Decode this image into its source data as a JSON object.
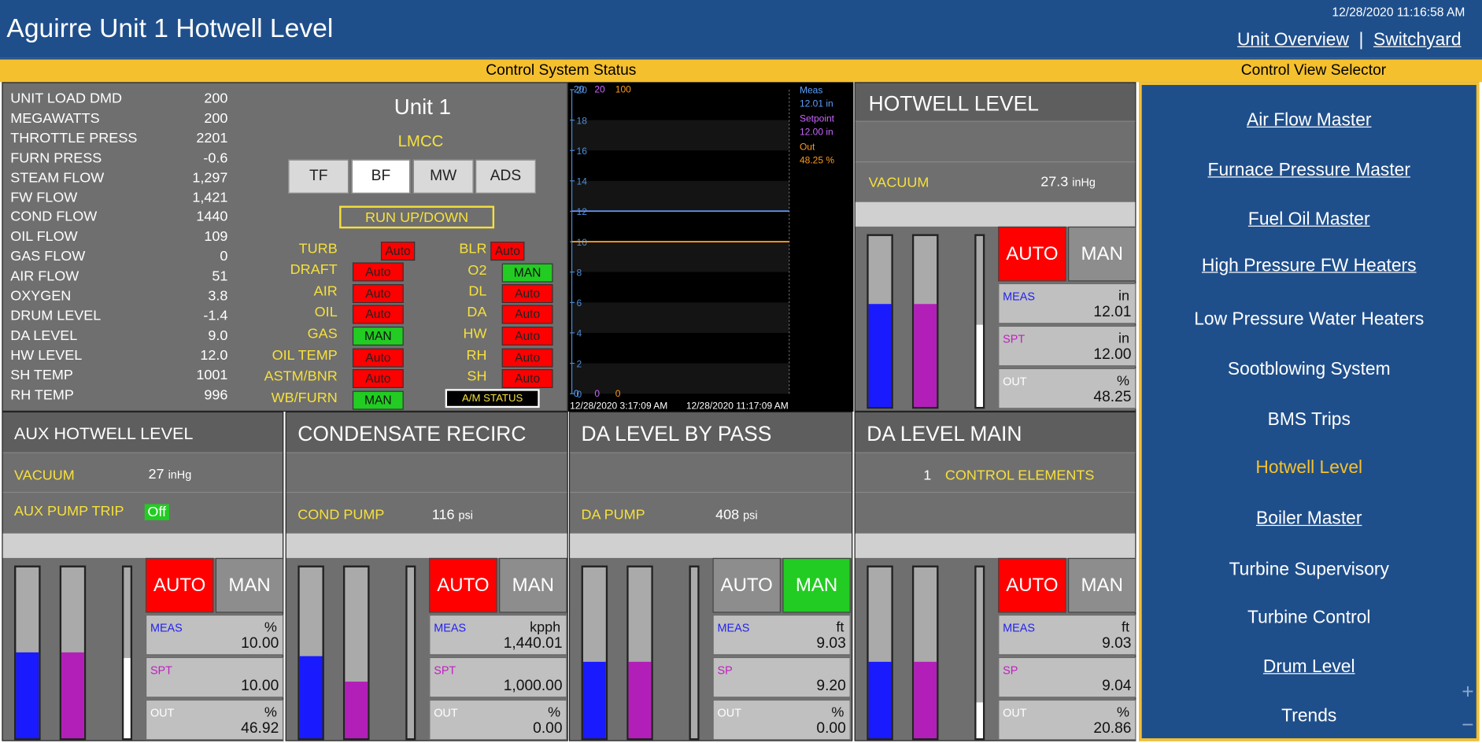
{
  "header": {
    "title": "Aguirre Unit 1 Hotwell Level",
    "timestamp": "12/28/2020 11:16:58 AM",
    "links": [
      "Unit Overview",
      "Switchyard"
    ],
    "separator": "|"
  },
  "bar": {
    "left": "Control System Status",
    "right": "Control View Selector"
  },
  "status_list": [
    {
      "label": "UNIT LOAD DMD",
      "value": "200"
    },
    {
      "label": "MEGAWATTS",
      "value": "200"
    },
    {
      "label": "THROTTLE PRESS",
      "value": "2201"
    },
    {
      "label": "FURN PRESS",
      "value": "-0.6"
    },
    {
      "label": "STEAM FLOW",
      "value": "1,297"
    },
    {
      "label": "FW FLOW",
      "value": "1,421"
    },
    {
      "label": "COND FLOW",
      "value": "1440"
    },
    {
      "label": "OIL FLOW",
      "value": "109"
    },
    {
      "label": "GAS FLOW",
      "value": "0"
    },
    {
      "label": "AIR FLOW",
      "value": "51"
    },
    {
      "label": "OXYGEN",
      "value": "3.8"
    },
    {
      "label": "DRUM LEVEL",
      "value": "-1.4"
    },
    {
      "label": "DA LEVEL",
      "value": "9.0"
    },
    {
      "label": "HW LEVEL",
      "value": "12.0"
    },
    {
      "label": "SH TEMP",
      "value": "1001"
    },
    {
      "label": "RH TEMP",
      "value": "996"
    }
  ],
  "unit": {
    "name": "Unit 1",
    "mode": "LMCC",
    "tabs": [
      "TF",
      "BF",
      "MW",
      "ADS"
    ],
    "run_button": "RUN UP/DOWN",
    "am_status": "A/M STATUS"
  },
  "am_left": [
    {
      "label": "TURB",
      "state": "Auto"
    },
    {
      "label": "DRAFT",
      "state": "Auto"
    },
    {
      "label": "AIR",
      "state": "Auto"
    },
    {
      "label": "OIL",
      "state": "Auto"
    },
    {
      "label": "GAS",
      "state": "MAN"
    },
    {
      "label": "OIL TEMP",
      "state": "Auto"
    },
    {
      "label": "ASTM/BNR",
      "state": "Auto"
    },
    {
      "label": "WB/FURN",
      "state": "MAN"
    }
  ],
  "am_right": [
    {
      "label": "BLR",
      "state": "Auto"
    },
    {
      "label": "O2",
      "state": "MAN"
    },
    {
      "label": "DL",
      "state": "Auto"
    },
    {
      "label": "DA",
      "state": "Auto"
    },
    {
      "label": "HW",
      "state": "Auto"
    },
    {
      "label": "RH",
      "state": "Auto"
    },
    {
      "label": "SH",
      "state": "Auto"
    }
  ],
  "chart_data": {
    "type": "line",
    "x_start": "12/28/2020 3:17:09 AM",
    "x_end": "12/28/2020 11:17:09 AM",
    "ylim": [
      0,
      20
    ],
    "yticks": [
      "20",
      "18",
      "16",
      "14",
      "12",
      "10",
      "8",
      "6",
      "4",
      "2",
      "0"
    ],
    "scale_labels_top": [
      "20",
      "20",
      "100"
    ],
    "scale_labels_bottom": [
      "0",
      "0",
      "0"
    ],
    "series": [
      {
        "name": "Meas",
        "value_label": "12.01 in",
        "value": 12.01,
        "color": "#5aa0ff"
      },
      {
        "name": "Setpoint",
        "value_label": "12.00 in",
        "value": 12.0,
        "color": "#cc66ff"
      },
      {
        "name": "Out",
        "value_label": "48.25 %",
        "value": 48.25,
        "color": "#ff9a1a"
      }
    ]
  },
  "hotwell": {
    "title": "HOTWELL LEVEL",
    "vacuum_label": "VACUUM",
    "vacuum_value": "27.3",
    "vacuum_unit": "inHg",
    "auto": "AUTO",
    "man": "MAN",
    "meas_label": "MEAS",
    "meas_unit": "in",
    "meas_value": "12.01",
    "spt_label": "SPT",
    "spt_unit": "in",
    "spt_value": "12.00",
    "out_label": "OUT",
    "out_unit": "%",
    "out_value": "48.25",
    "bars": {
      "meas": 0.6,
      "spt": 0.6,
      "out": 0.48
    }
  },
  "aux": {
    "title": "AUX HOTWELL LEVEL",
    "vacuum_label": "VACUUM",
    "vacuum_value": "27",
    "vacuum_unit": "inHg",
    "trip_label": "AUX PUMP TRIP",
    "trip_value": "Off",
    "auto": "AUTO",
    "man": "MAN",
    "meas_label": "MEAS",
    "meas_unit": "%",
    "meas_value": "10.00",
    "spt_label": "SPT",
    "spt_value": "10.00",
    "out_label": "OUT",
    "out_unit": "%",
    "out_value": "46.92",
    "bars": {
      "meas": 0.5,
      "spt": 0.5,
      "out": 0.47
    }
  },
  "cond": {
    "title": "CONDENSATE RECIRC",
    "pump_label": "COND PUMP",
    "pump_value": "116",
    "pump_unit": "psi",
    "auto": "AUTO",
    "man": "MAN",
    "meas_label": "MEAS",
    "meas_unit": "kpph",
    "meas_value": "1,440.01",
    "spt_label": "SPT",
    "spt_value": "1,000.00",
    "out_label": "OUT",
    "out_unit": "%",
    "out_value": "0.00",
    "bars": {
      "meas": 0.48,
      "spt": 0.33,
      "out": 0.0
    }
  },
  "dabypass": {
    "title": "DA LEVEL BY PASS",
    "pump_label": "DA PUMP",
    "pump_value": "408",
    "pump_unit": "psi",
    "auto": "AUTO",
    "man": "MAN",
    "meas_label": "MEAS",
    "meas_unit": "ft",
    "meas_value": "9.03",
    "spt_label": "SP",
    "spt_value": "9.20",
    "out_label": "OUT",
    "out_unit": "%",
    "out_value": "0.00",
    "bars": {
      "meas": 0.45,
      "spt": 0.45,
      "out": 0.0
    }
  },
  "damain": {
    "title": "DA LEVEL MAIN",
    "ce_count": "1",
    "ce_label": "CONTROL ELEMENTS",
    "auto": "AUTO",
    "man": "MAN",
    "meas_label": "MEAS",
    "meas_unit": "ft",
    "meas_value": "9.03",
    "spt_label": "SP",
    "spt_value": "9.04",
    "out_label": "OUT",
    "out_unit": "%",
    "out_value": "20.86",
    "bars": {
      "meas": 0.45,
      "spt": 0.45,
      "out": 0.21
    }
  },
  "nav": [
    {
      "label": "Air Flow Master",
      "underline": true
    },
    {
      "label": "Furnace Pressure Master",
      "underline": true
    },
    {
      "label": "Fuel Oil Master",
      "underline": true
    },
    {
      "label": "High Pressure FW Heaters",
      "underline": true
    },
    {
      "label": "Low Pressure Water Heaters",
      "underline": false
    },
    {
      "label": "Sootblowing System",
      "underline": false
    },
    {
      "label": "BMS Trips",
      "underline": false
    },
    {
      "label": "Hotwell Level",
      "underline": false,
      "current": true
    },
    {
      "label": "Boiler Master",
      "underline": true
    },
    {
      "label": "Turbine Supervisory",
      "underline": false
    },
    {
      "label": "Turbine Control",
      "underline": false
    },
    {
      "label": "Drum Level",
      "underline": true
    },
    {
      "label": "Trends",
      "underline": false
    }
  ],
  "zoom": {
    "plus": "+",
    "minus": "−"
  }
}
